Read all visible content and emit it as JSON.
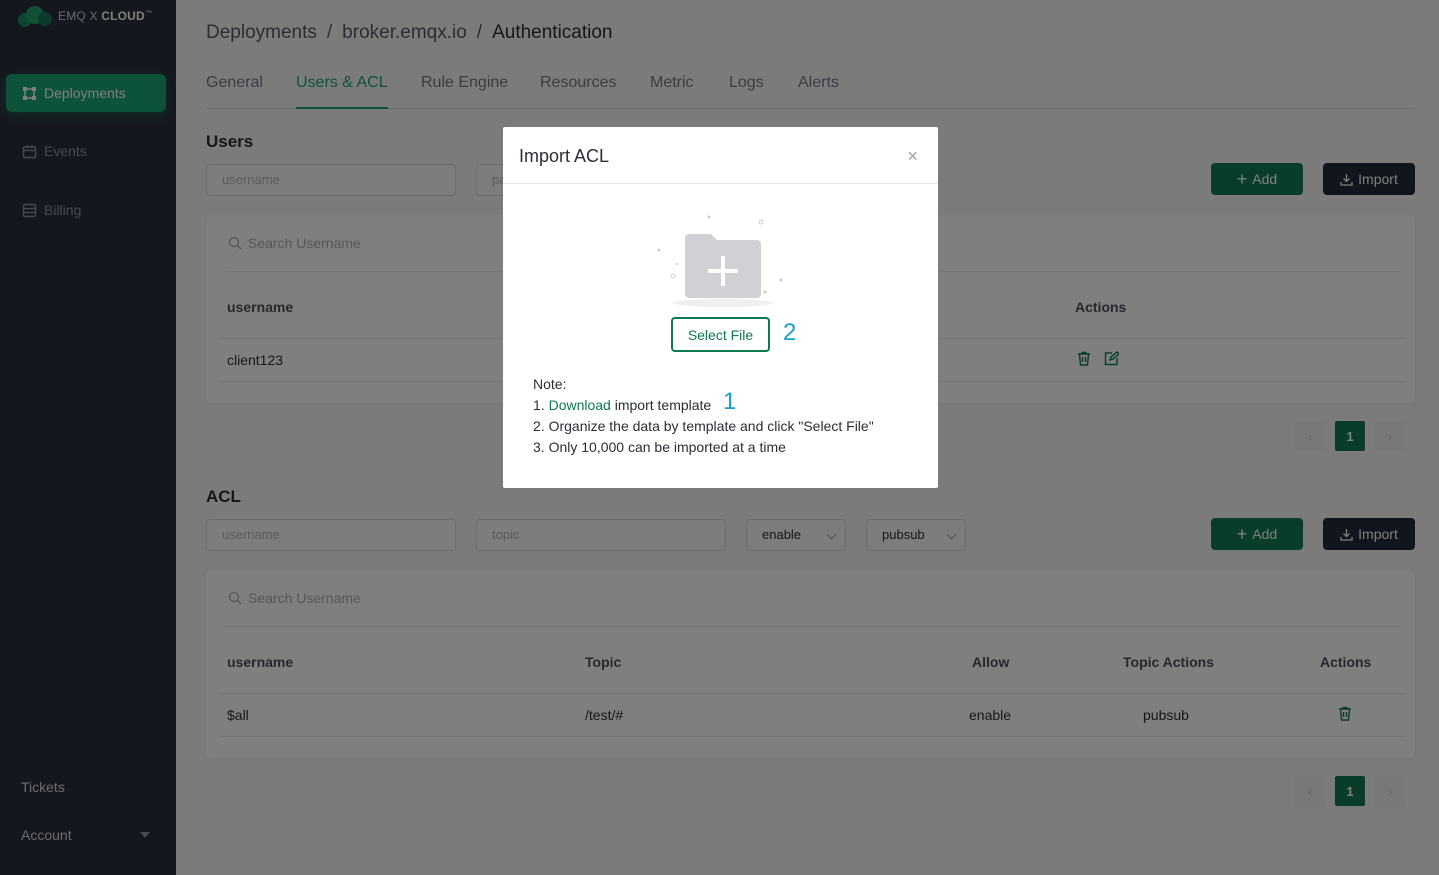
{
  "brand": {
    "prefix": "EMQ X ",
    "name": "CLOUD",
    "mark": "™"
  },
  "sidebar": {
    "items": [
      {
        "label": "Deployments",
        "active": true,
        "icon": "deployments-icon"
      },
      {
        "label": "Events",
        "active": false,
        "icon": "calendar-icon"
      },
      {
        "label": "Billing",
        "active": false,
        "icon": "billing-icon"
      }
    ],
    "tickets": "Tickets",
    "account": "Account"
  },
  "breadcrumb": [
    "Deployments",
    "/",
    "broker.emqx.io",
    "/",
    "Authentication"
  ],
  "tabs": [
    "General",
    "Users & ACL",
    "Rule Engine",
    "Resources",
    "Metric",
    "Logs",
    "Alerts"
  ],
  "users": {
    "title": "Users",
    "username_placeholder": "username",
    "password_placeholder": "pa",
    "add_label": "Add",
    "import_label": "Import",
    "search_placeholder": "Search Username",
    "columns": {
      "username": "username",
      "actions": "Actions"
    },
    "rows": [
      {
        "username": "client123"
      }
    ],
    "page": "1"
  },
  "acl": {
    "title": "ACL",
    "username_placeholder": "username",
    "topic_placeholder": "topic",
    "allow_value": "enable",
    "action_value": "pubsub",
    "add_label": "Add",
    "import_label": "Import",
    "search_placeholder": "Search Username",
    "columns": {
      "username": "username",
      "topic": "Topic",
      "allow": "Allow",
      "topic_actions": "Topic Actions",
      "actions": "Actions"
    },
    "rows": [
      {
        "username": "$all",
        "topic": "/test/#",
        "allow": "enable",
        "topic_actions": "pubsub"
      }
    ],
    "page": "1"
  },
  "modal": {
    "title": "Import ACL",
    "close": "×",
    "select_file": "Select File",
    "annotation_select": "2",
    "annotation_download": "1",
    "note_label": "Note:",
    "note1_prefix": "1. ",
    "note1_link": "Download",
    "note1_suffix": " import template",
    "note2": "2. Organize the data by template and click \"Select File\"",
    "note3": "3. Only 10,000 can be imported at a time"
  },
  "colors": {
    "sidebar_bg": "#2b2f3d",
    "accent": "#1ba673",
    "primary_btn": "#0e7a52",
    "import_btn": "#232a3a",
    "annotation": "#1ba0c8"
  }
}
